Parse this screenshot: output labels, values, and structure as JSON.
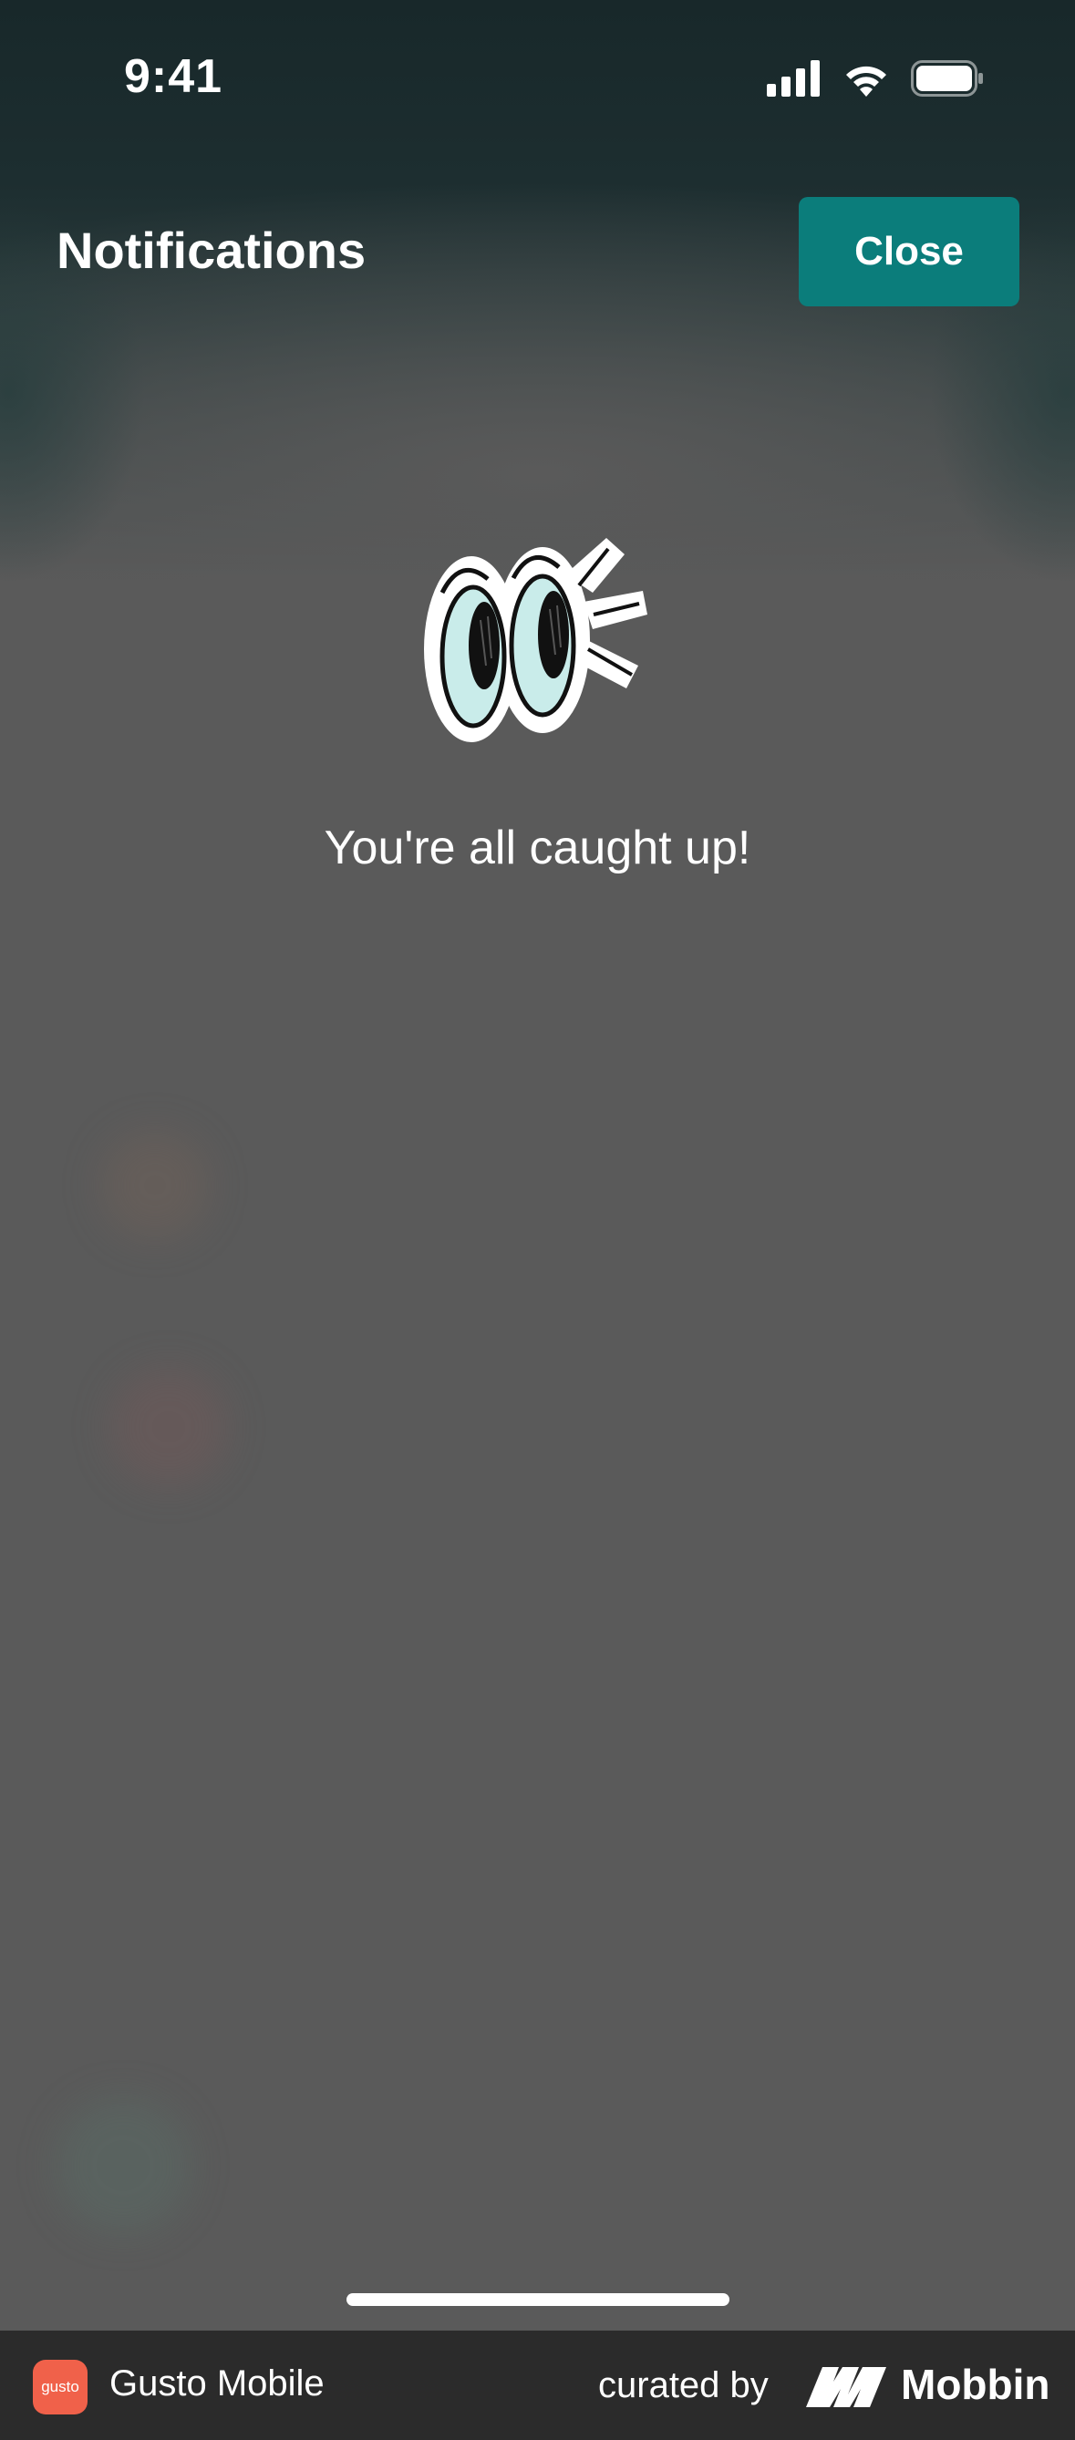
{
  "status_bar": {
    "time": "9:41",
    "icons": [
      "cellular-signal-icon",
      "wifi-icon",
      "battery-icon"
    ]
  },
  "header": {
    "title": "Notifications",
    "close_label": "Close"
  },
  "empty_state": {
    "illustration": "googly-eyes-icon",
    "message": "You're all caught up!"
  },
  "footer": {
    "app_icon_text": "gusto",
    "app_name": "Gusto Mobile",
    "curated_label": "curated by",
    "brand": "Mobbin"
  },
  "colors": {
    "accent": "#0b7d7b",
    "overlay": "#5a5a5a",
    "header_shade": "#18282a",
    "app_icon": "#f0614a"
  }
}
